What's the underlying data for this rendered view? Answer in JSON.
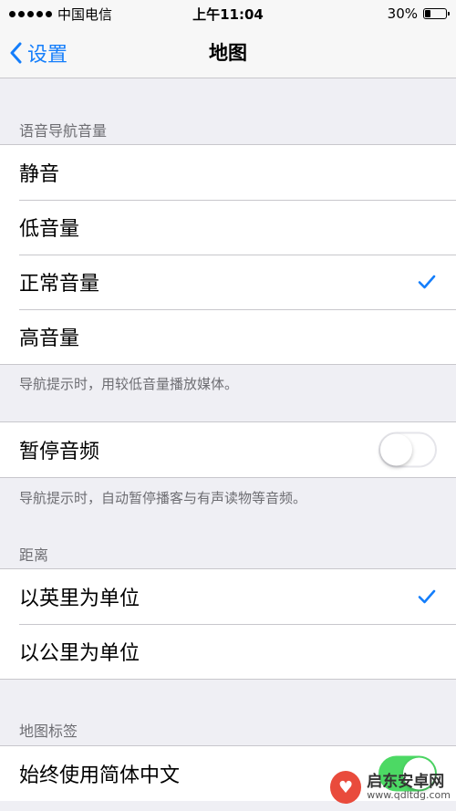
{
  "status_bar": {
    "carrier": "中国电信",
    "time": "上午11:04",
    "battery": "30%",
    "battery_level": 0.3
  },
  "nav": {
    "back_label": "设置",
    "title": "地图"
  },
  "voice_volume": {
    "header": "语音导航音量",
    "options": [
      "静音",
      "低音量",
      "正常音量",
      "高音量"
    ],
    "selected": "正常音量",
    "footer": "导航提示时，用较低音量播放媒体。"
  },
  "pause_audio": {
    "label": "暂停音频",
    "enabled": false,
    "footer": "导航提示时，自动暂停播客与有声读物等音频。"
  },
  "distance": {
    "header": "距离",
    "options": [
      "以英里为单位",
      "以公里为单位"
    ],
    "selected": "以英里为单位"
  },
  "map_labels": {
    "header": "地图标签",
    "always_simplified_label": "始终使用简体中文",
    "enabled": true
  },
  "watermark": {
    "title": "启东安卓网",
    "url": "www.qdltdg.com"
  },
  "colors": {
    "accent": "#147efb",
    "toggle_on": "#4cd964",
    "background": "#efeff4"
  }
}
